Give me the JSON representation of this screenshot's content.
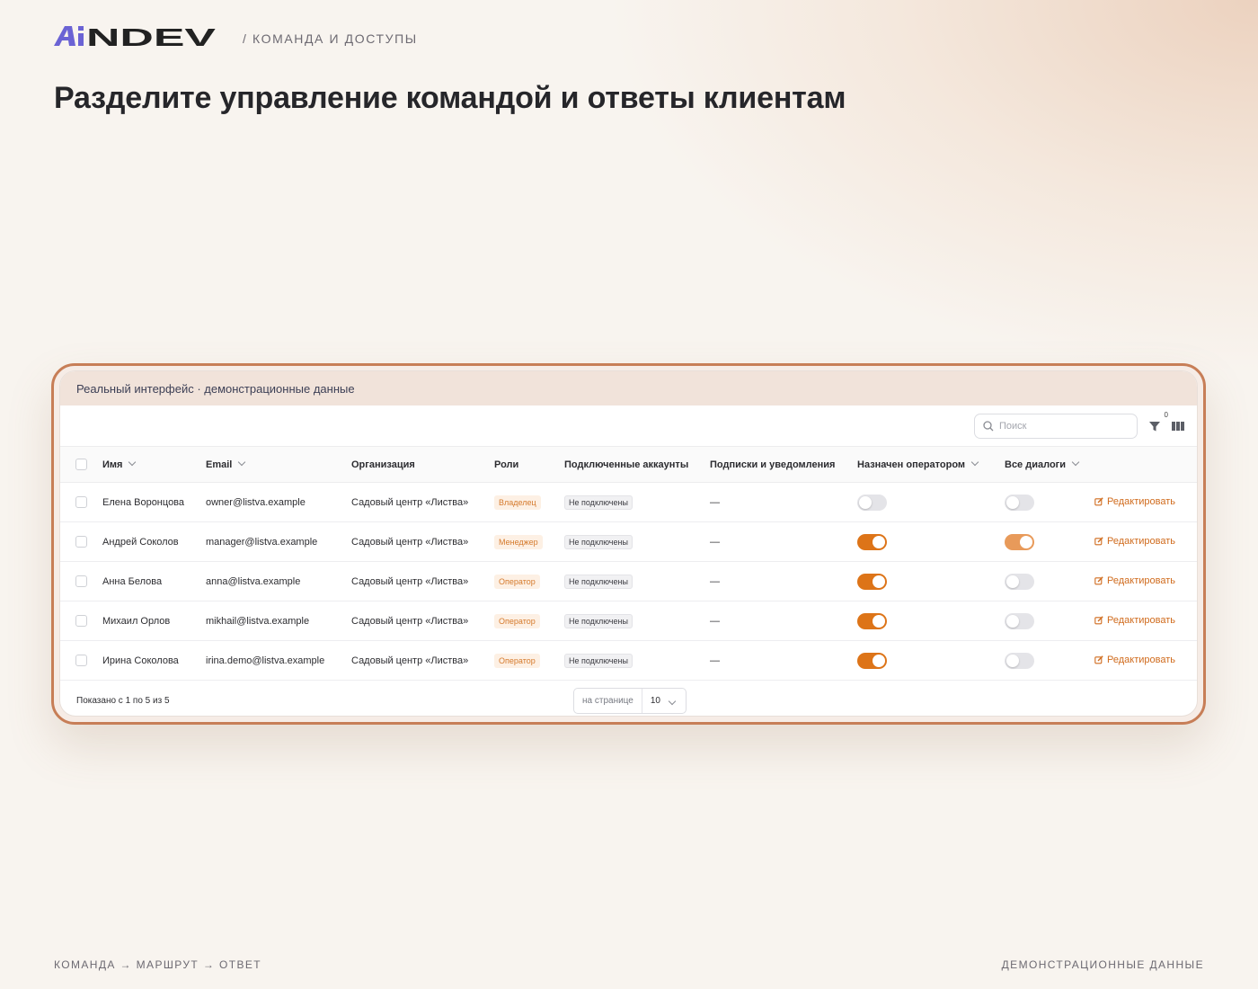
{
  "brand": {
    "logo_text": "AiNDEV",
    "logo_color": "#6b63d4"
  },
  "header": {
    "breadcrumb": "/ КОМАНДА И ДОСТУПЫ"
  },
  "headline": "Разделите управление командой и ответы клиентам",
  "card": {
    "caption": "Реальный интерфейс · демонстрационные данные",
    "search_placeholder": "Поиск",
    "filter_count": "0",
    "columns": [
      "Имя",
      "Email",
      "Организация",
      "Роли",
      "Подключенные аккаунты",
      "Подписки и уведомления",
      "Назначен оператором",
      "Все диалоги"
    ],
    "rows": [
      {
        "name": "Елена Воронцова",
        "email": "owner@listva.example",
        "org": "Садовый центр «Листва»",
        "role": "Владелец",
        "accounts": "Не подключены",
        "subs": "—",
        "operator": false,
        "all_dialogs": false,
        "edit": "Редактировать"
      },
      {
        "name": "Андрей Соколов",
        "email": "manager@listva.example",
        "org": "Садовый центр «Листва»",
        "role": "Менеджер",
        "accounts": "Не подключены",
        "subs": "—",
        "operator": true,
        "all_dialogs": true,
        "edit": "Редактировать"
      },
      {
        "name": "Анна Белова",
        "email": "anna@listva.example",
        "org": "Садовый центр «Листва»",
        "role": "Оператор",
        "accounts": "Не подключены",
        "subs": "—",
        "operator": true,
        "all_dialogs": false,
        "edit": "Редактировать"
      },
      {
        "name": "Михаил Орлов",
        "email": "mikhail@listva.example",
        "org": "Садовый центр «Листва»",
        "role": "Оператор",
        "accounts": "Не подключены",
        "subs": "—",
        "operator": true,
        "all_dialogs": false,
        "edit": "Редактировать"
      },
      {
        "name": "Ирина Соколова",
        "email": "irina.demo@listva.example",
        "org": "Садовый центр «Листва»",
        "role": "Оператор",
        "accounts": "Не подключены",
        "subs": "—",
        "operator": true,
        "all_dialogs": false,
        "edit": "Редактировать"
      }
    ],
    "shown_text": "Показано с 1 по 5 из 5",
    "per_page_label": "на странице",
    "per_page_value": "10"
  },
  "footer": {
    "left": "КОМАНДА → МАРШРУТ → ОТВЕТ",
    "right": "ДЕМОНСТРАЦИОННЫЕ ДАННЫЕ"
  },
  "colors": {
    "accent": "#dd7418",
    "frame": "#c77e57"
  }
}
